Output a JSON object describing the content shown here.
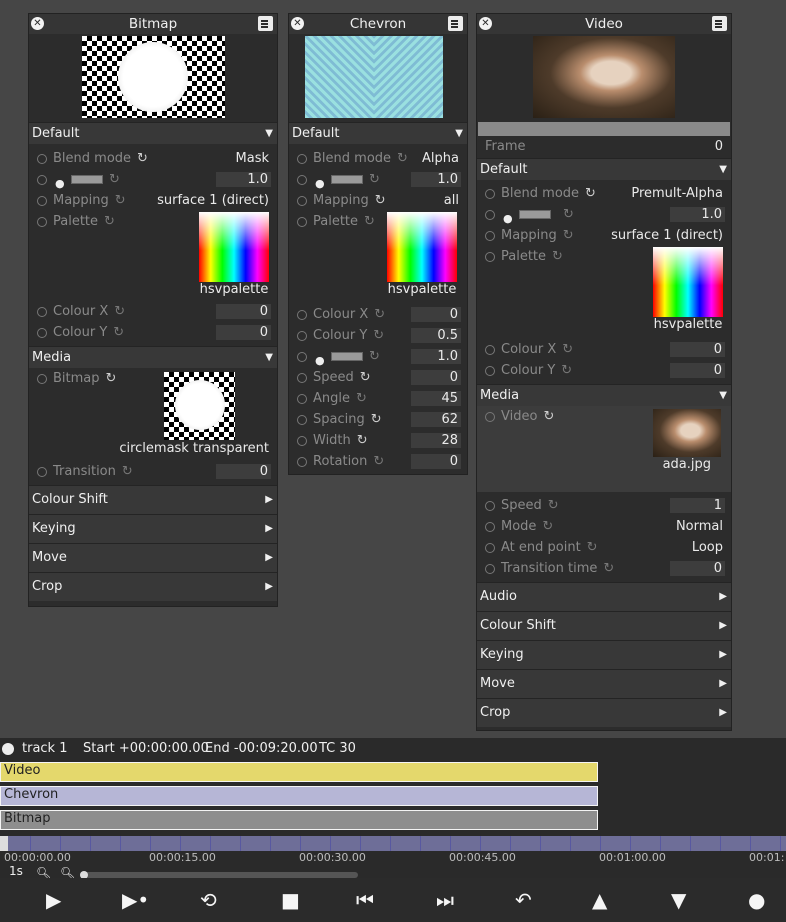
{
  "panels": {
    "bitmap": {
      "title": "Bitmap",
      "default_section": "Default",
      "blend_mode_label": "Blend mode",
      "blend_mode_value": "Mask",
      "opacity_value": "1.0",
      "mapping_label": "Mapping",
      "mapping_value": "surface 1 (direct)",
      "palette_label": "Palette",
      "palette_name": "hsvpalette",
      "colour_x_label": "Colour X",
      "colour_x_value": "0",
      "colour_y_label": "Colour Y",
      "colour_y_value": "0",
      "media_section": "Media",
      "bitmap_label": "Bitmap",
      "bitmap_name": "circlemask transparent",
      "transition_label": "Transition",
      "transition_value": "0",
      "collapsed_sections": [
        "Colour Shift",
        "Keying",
        "Move",
        "Crop"
      ]
    },
    "chevron": {
      "title": "Chevron",
      "default_section": "Default",
      "blend_mode_label": "Blend mode",
      "blend_mode_value": "Alpha",
      "opacity_value": "1.0",
      "mapping_label": "Mapping",
      "mapping_value": "all",
      "palette_label": "Palette",
      "palette_name": "hsvpalette",
      "colour_x_label": "Colour X",
      "colour_x_value": "0",
      "colour_y_label": "Colour Y",
      "colour_y_value": "0.5",
      "opacity2_value": "1.0",
      "speed_label": "Speed",
      "speed_value": "0",
      "angle_label": "Angle",
      "angle_value": "45",
      "spacing_label": "Spacing",
      "spacing_value": "62",
      "width_label": "Width",
      "width_value": "28",
      "rotation_label": "Rotation",
      "rotation_value": "0"
    },
    "video": {
      "title": "Video",
      "frame_label": "Frame",
      "frame_value": "0",
      "default_section": "Default",
      "blend_mode_label": "Blend mode",
      "blend_mode_value": "Premult-Alpha",
      "opacity_value": "1.0",
      "mapping_label": "Mapping",
      "mapping_value": "surface 1 (direct)",
      "palette_label": "Palette",
      "palette_name": "hsvpalette",
      "colour_x_label": "Colour X",
      "colour_x_value": "0",
      "colour_y_label": "Colour Y",
      "colour_y_value": "0",
      "media_section": "Media",
      "video_label": "Video",
      "video_name": "ada.jpg",
      "speed_label": "Speed",
      "speed_value": "1",
      "mode_label": "Mode",
      "mode_value": "Normal",
      "end_label": "At end point",
      "end_value": "Loop",
      "transition_label": "Transition time",
      "transition_value": "0",
      "collapsed_sections": [
        "Audio",
        "Colour Shift",
        "Keying",
        "Move",
        "Crop"
      ]
    }
  },
  "timeline": {
    "track_name": "track 1",
    "start": "Start +00:00:00.00",
    "end": "End -00:09:20.00",
    "tc": "TC 30",
    "tracks": [
      {
        "name": "Video",
        "color": "#e4d86c"
      },
      {
        "name": "Chevron",
        "color": "#b6b6d6"
      },
      {
        "name": "Bitmap",
        "color": "#8e8e8e"
      }
    ],
    "time_labels": [
      "00:00:00.00",
      "00:00:15.00",
      "00:00:30.00",
      "00:00:45.00",
      "00:01:00.00",
      "00:01:"
    ],
    "zoom_label": "1s"
  },
  "controls": {
    "icons": [
      "play-icon",
      "play-step-icon",
      "loop-icon",
      "stop-icon",
      "skip-back-icon",
      "skip-forward-icon",
      "undo-icon",
      "up-icon",
      "down-icon",
      "record-icon"
    ]
  }
}
